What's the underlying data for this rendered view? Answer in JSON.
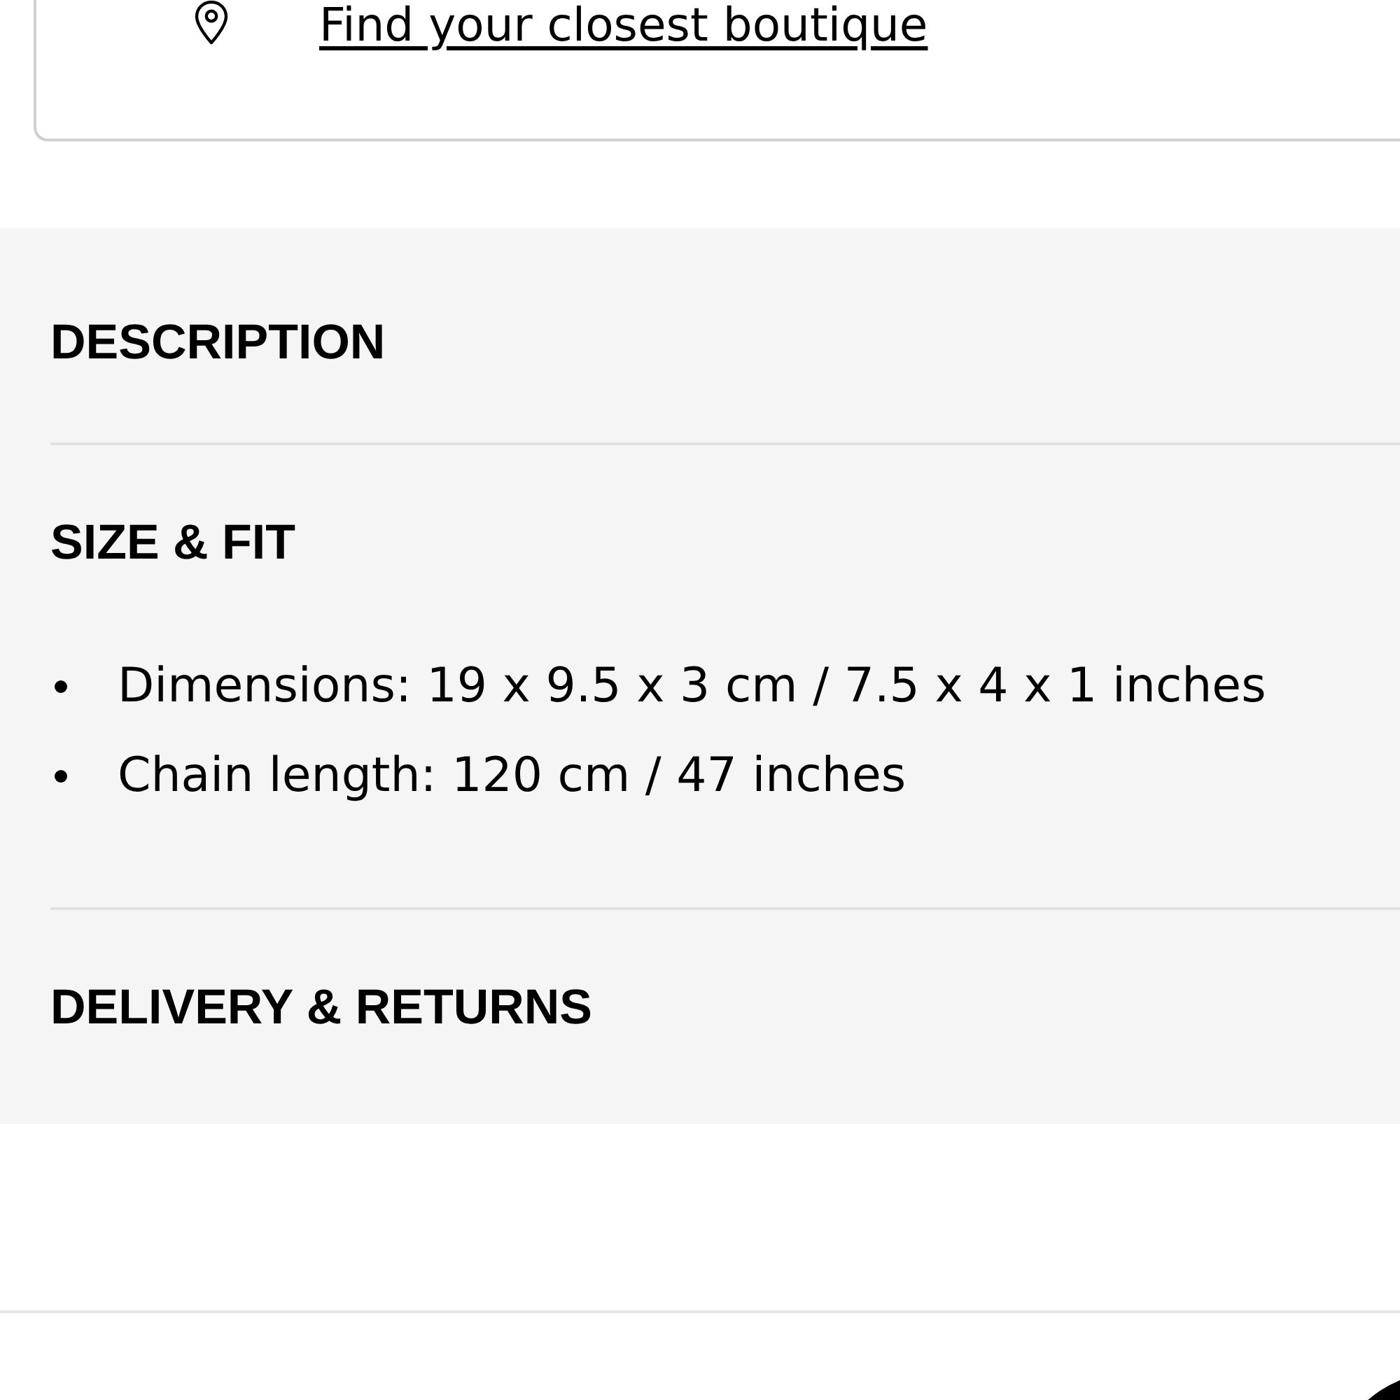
{
  "boutique_link": {
    "label": "Find your closest boutique"
  },
  "sections": [
    {
      "title": "DESCRIPTION"
    },
    {
      "title": "SIZE & FIT",
      "items": [
        "Dimensions: 19 x 9.5 x 3 cm / 7.5 x 4 x 1 inches",
        "Chain length: 120 cm / 47 inches"
      ]
    },
    {
      "title": "DELIVERY & RETURNS"
    }
  ]
}
